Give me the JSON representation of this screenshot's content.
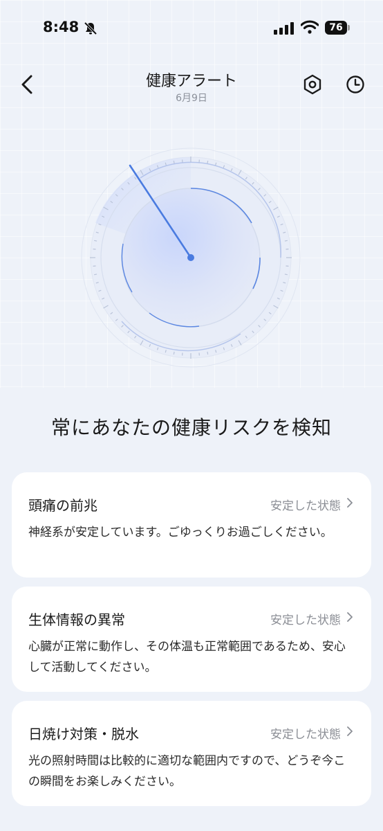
{
  "status_bar": {
    "time": "8:48",
    "battery": "76"
  },
  "header": {
    "title": "健康アラート",
    "date": "6月9日"
  },
  "headline": "常にあなたの健康リスクを検知",
  "cards": [
    {
      "title": "頭痛の前兆",
      "status": "安定した状態",
      "description": "神経系が安定しています。ごゆっくりお過ごしください。"
    },
    {
      "title": "生体情報の異常",
      "status": "安定した状態",
      "description": "心臓が正常に動作し、その体温も正常範囲であるため、安心して活動してください。"
    },
    {
      "title": "日焼け対策・脱水",
      "status": "安定した状態",
      "description": "光の照射時間は比較的に適切な範囲内ですので、どうぞ今この瞬間をお楽しみください。"
    }
  ],
  "colors": {
    "accent": "#4a7be0",
    "background": "#eef2f9",
    "card": "#ffffff",
    "status_text": "#8b8e95"
  },
  "icons": {
    "back": "chevron-left-icon",
    "settings": "hexagon-gear-icon",
    "history": "clock-icon",
    "mute": "bell-slash-icon",
    "signal": "cellular-signal-icon",
    "wifi": "wifi-icon",
    "battery": "battery-icon",
    "card_chevron": "chevron-right-icon"
  }
}
